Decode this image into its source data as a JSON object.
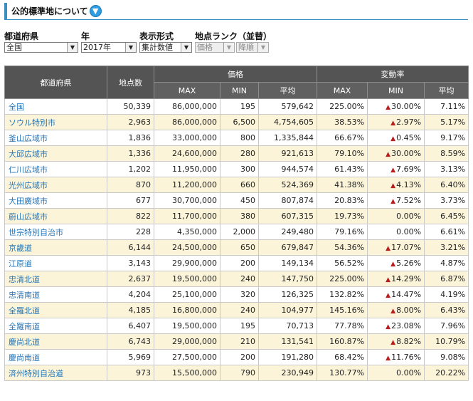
{
  "header": {
    "title": "公的標準地について",
    "help_icon": "down-arrow-circle-icon"
  },
  "filters": {
    "prefecture": {
      "label": "都道府県",
      "value": "全国"
    },
    "year": {
      "label": "年",
      "value": "2017年"
    },
    "display": {
      "label": "表示形式",
      "value": "集計数値"
    },
    "rank": {
      "label": "地点ランク（並替）",
      "value": "価格",
      "order": "降順"
    }
  },
  "table": {
    "col_pref": "都道府県",
    "col_count": "地点数",
    "group_price": "価格",
    "group_rate": "変動率",
    "sub_headers": [
      "MAX",
      "MIN",
      "平均",
      "MAX",
      "MIN",
      "平均"
    ],
    "rows": [
      {
        "name": "全国",
        "count": "50,339",
        "pmax": "86,000,000",
        "pmin": "195",
        "pavg": "579,642",
        "rmax": "225.00%",
        "rmin": "30.00%",
        "rmin_neg": true,
        "ravg": "7.11%"
      },
      {
        "name": "ソウル特別市",
        "count": "2,963",
        "pmax": "86,000,000",
        "pmin": "6,500",
        "pavg": "4,754,605",
        "rmax": "38.53%",
        "rmin": "2.97%",
        "rmin_neg": true,
        "ravg": "5.17%"
      },
      {
        "name": "釜山広域市",
        "count": "1,836",
        "pmax": "33,000,000",
        "pmin": "800",
        "pavg": "1,335,844",
        "rmax": "66.67%",
        "rmin": "0.45%",
        "rmin_neg": true,
        "ravg": "9.17%"
      },
      {
        "name": "大邱広域市",
        "count": "1,336",
        "pmax": "24,600,000",
        "pmin": "280",
        "pavg": "921,613",
        "rmax": "79.10%",
        "rmin": "30.00%",
        "rmin_neg": true,
        "ravg": "8.59%"
      },
      {
        "name": "仁川広域市",
        "count": "1,202",
        "pmax": "11,950,000",
        "pmin": "300",
        "pavg": "944,574",
        "rmax": "61.43%",
        "rmin": "7.69%",
        "rmin_neg": true,
        "ravg": "3.13%"
      },
      {
        "name": "光州広域市",
        "count": "870",
        "pmax": "11,200,000",
        "pmin": "660",
        "pavg": "524,369",
        "rmax": "41.38%",
        "rmin": "4.13%",
        "rmin_neg": true,
        "ravg": "6.40%"
      },
      {
        "name": "大田廣域市",
        "count": "677",
        "pmax": "30,700,000",
        "pmin": "450",
        "pavg": "807,874",
        "rmax": "20.83%",
        "rmin": "7.52%",
        "rmin_neg": true,
        "ravg": "3.73%"
      },
      {
        "name": "蔚山広域市",
        "count": "822",
        "pmax": "11,700,000",
        "pmin": "380",
        "pavg": "607,315",
        "rmax": "19.73%",
        "rmin": "0.00%",
        "rmin_neg": false,
        "ravg": "6.45%"
      },
      {
        "name": "世宗特別自治市",
        "count": "228",
        "pmax": "4,350,000",
        "pmin": "2,000",
        "pavg": "249,480",
        "rmax": "79.16%",
        "rmin": "0.00%",
        "rmin_neg": false,
        "ravg": "6.61%"
      },
      {
        "name": "京畿道",
        "count": "6,144",
        "pmax": "24,500,000",
        "pmin": "650",
        "pavg": "679,847",
        "rmax": "54.36%",
        "rmin": "17.07%",
        "rmin_neg": true,
        "ravg": "3.21%"
      },
      {
        "name": "江原道",
        "count": "3,143",
        "pmax": "29,900,000",
        "pmin": "200",
        "pavg": "149,134",
        "rmax": "56.52%",
        "rmin": "5.26%",
        "rmin_neg": true,
        "ravg": "4.87%"
      },
      {
        "name": "忠清北道",
        "count": "2,637",
        "pmax": "19,500,000",
        "pmin": "240",
        "pavg": "147,750",
        "rmax": "225.00%",
        "rmin": "14.29%",
        "rmin_neg": true,
        "ravg": "6.87%"
      },
      {
        "name": "忠清南道",
        "count": "4,204",
        "pmax": "25,100,000",
        "pmin": "320",
        "pavg": "126,325",
        "rmax": "132.82%",
        "rmin": "14.47%",
        "rmin_neg": true,
        "ravg": "4.19%"
      },
      {
        "name": "全羅北道",
        "count": "4,185",
        "pmax": "16,800,000",
        "pmin": "240",
        "pavg": "104,977",
        "rmax": "145.16%",
        "rmin": "8.00%",
        "rmin_neg": true,
        "ravg": "6.43%"
      },
      {
        "name": "全羅南道",
        "count": "6,407",
        "pmax": "19,500,000",
        "pmin": "195",
        "pavg": "70,713",
        "rmax": "77.78%",
        "rmin": "23.08%",
        "rmin_neg": true,
        "ravg": "7.96%"
      },
      {
        "name": "慶尚北道",
        "count": "6,743",
        "pmax": "29,000,000",
        "pmin": "210",
        "pavg": "131,541",
        "rmax": "160.87%",
        "rmin": "8.82%",
        "rmin_neg": true,
        "ravg": "10.79%"
      },
      {
        "name": "慶尚南道",
        "count": "5,969",
        "pmax": "27,500,000",
        "pmin": "200",
        "pavg": "191,280",
        "rmax": "68.42%",
        "rmin": "11.76%",
        "rmin_neg": true,
        "ravg": "9.08%"
      },
      {
        "name": "済州特別自治道",
        "count": "973",
        "pmax": "15,500,000",
        "pmin": "790",
        "pavg": "230,949",
        "rmax": "130.77%",
        "rmin": "0.00%",
        "rmin_neg": false,
        "ravg": "20.22%"
      }
    ]
  },
  "colors": {
    "accent": "#3a8ec4",
    "header_bg": "#545454",
    "link": "#2676b8",
    "row_alt": "#fbf4d8",
    "negative": "#b81e1e"
  }
}
